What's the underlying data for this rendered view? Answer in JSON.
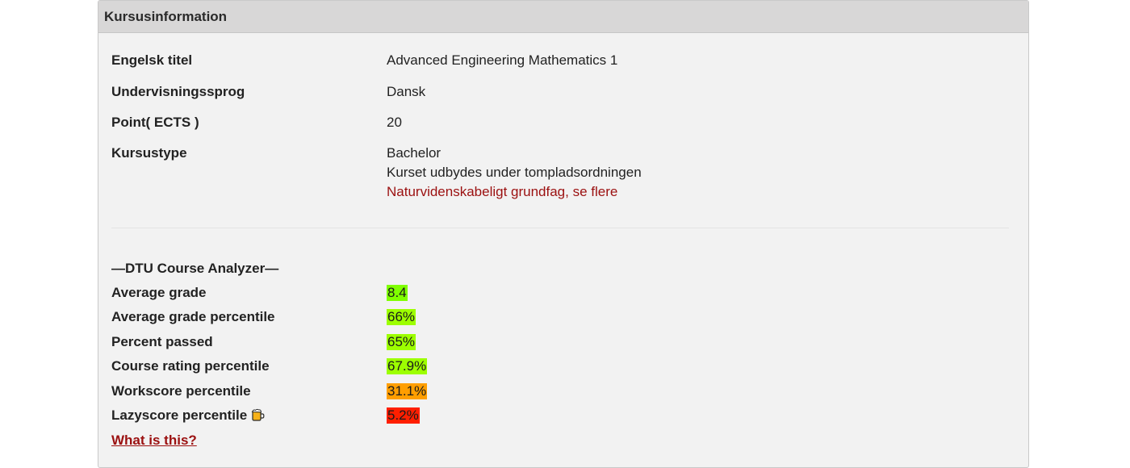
{
  "panel": {
    "title": "Kursusinformation"
  },
  "info": [
    {
      "label": "Engelsk titel",
      "value": "Advanced Engineering Mathematics 1"
    },
    {
      "label": "Undervisningssprog",
      "value": "Dansk"
    },
    {
      "label": "Point( ECTS )",
      "value": "20"
    },
    {
      "label": "Kursustype",
      "lines": [
        "Bachelor",
        "Kurset udbydes under tompladsordningen"
      ],
      "link": "Naturvidenskabeligt grundfag, se flere"
    }
  ],
  "analyzer": {
    "title": "—DTU Course Analyzer—",
    "rows": [
      {
        "label": "Average grade",
        "value": "8.4",
        "color": "#7fff00"
      },
      {
        "label": "Average grade percentile",
        "value": "66%",
        "color": "#9dff00"
      },
      {
        "label": "Percent passed",
        "value": "65%",
        "color": "#9dff00"
      },
      {
        "label": "Course rating percentile",
        "value": "67.9%",
        "color": "#9dff00"
      },
      {
        "label": "Workscore percentile",
        "value": "31.1%",
        "color": "#ff9e00"
      },
      {
        "label": "Lazyscore percentile",
        "value": "5.2%",
        "color": "#ff1f00",
        "icon": "beer-icon"
      }
    ],
    "help_link": "What is this?"
  },
  "colors": {
    "link": "#9b1010",
    "header_bg": "#d8d7d7",
    "panel_bg": "#f2f2f2"
  }
}
